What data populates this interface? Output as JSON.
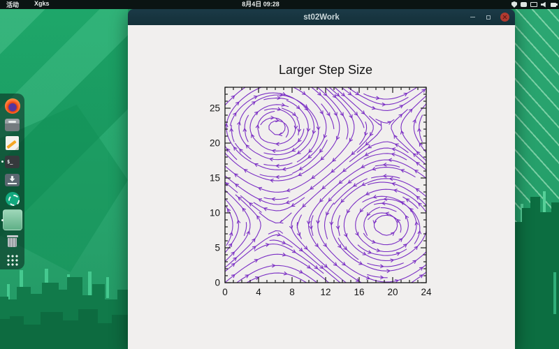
{
  "desktop": {
    "topbar": {
      "activities": "活动",
      "app_menu": "Xgks",
      "clock": "8月4日 09:28",
      "status_icons": [
        "shield-icon",
        "touchpad-icon",
        "display-icon",
        "volume-icon",
        "battery-icon"
      ]
    },
    "dock": {
      "terminal_prompt": "$_",
      "items": [
        {
          "id": "firefox",
          "running": false
        },
        {
          "id": "archive-manager",
          "running": false
        },
        {
          "id": "text-editor",
          "running": false
        },
        {
          "id": "terminal",
          "running": true
        },
        {
          "id": "downloads",
          "running": false
        },
        {
          "id": "software-update",
          "running": false
        },
        {
          "id": "xgks-window-thumbnail",
          "running": true
        },
        {
          "id": "trash",
          "running": false
        },
        {
          "id": "app-grid",
          "running": false
        }
      ]
    }
  },
  "window": {
    "title": "st02Work"
  },
  "chart_data": {
    "type": "streamline",
    "title": "Larger Step Size",
    "xlabel": "",
    "ylabel": "",
    "xlim": [
      0,
      24
    ],
    "ylim": [
      0,
      28
    ],
    "xticks": [
      0,
      4,
      8,
      12,
      16,
      20,
      24
    ],
    "yticks": [
      0,
      5,
      10,
      15,
      20,
      25
    ],
    "minor_tick_interval": 1,
    "grid": false,
    "legend": "none",
    "line_color": "#7b2fc4",
    "frame_color": "#1a1a1a",
    "background": "#f1efee",
    "vortices": [
      {
        "x": 6,
        "y": 22,
        "rotation": "clockwise"
      },
      {
        "x": 19,
        "y": 8,
        "rotation": "counterclockwise"
      }
    ],
    "saddles": [
      {
        "x": 6,
        "y": 8
      },
      {
        "x": 19,
        "y": 22
      }
    ],
    "field": {
      "u": "sin(pi*(y-22)/14)",
      "v": "-sin(pi*(x-6)/13)",
      "uy0": 22,
      "uyl": 14,
      "vx0": 6,
      "vxl": 13
    },
    "integration": {
      "method": "euler",
      "step": 0.5,
      "separation": 0.72,
      "seed_spacing": 1.6,
      "arrow_every": 7
    }
  }
}
